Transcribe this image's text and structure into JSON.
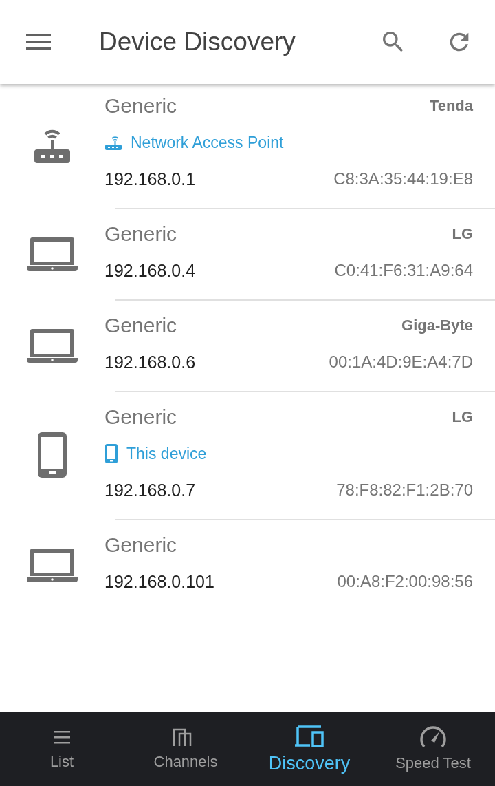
{
  "app_bar": {
    "title": "Device Discovery"
  },
  "devices": [
    {
      "kind": "router",
      "name": "Generic",
      "vendor": "Tenda",
      "tag": {
        "kind": "access-point",
        "label": "Network Access Point"
      },
      "ip": "192.168.0.1",
      "mac": "C8:3A:35:44:19:E8"
    },
    {
      "kind": "laptop",
      "name": "Generic",
      "vendor": "LG",
      "ip": "192.168.0.4",
      "mac": "C0:41:F6:31:A9:64"
    },
    {
      "kind": "laptop",
      "name": "Generic",
      "vendor": "Giga-Byte",
      "ip": "192.168.0.6",
      "mac": "00:1A:4D:9E:A4:7D"
    },
    {
      "kind": "phone",
      "name": "Generic",
      "vendor": "LG",
      "tag": {
        "kind": "this-device",
        "label": "This device"
      },
      "ip": "192.168.0.7",
      "mac": "78:F8:82:F1:2B:70"
    },
    {
      "kind": "laptop",
      "name": "Generic",
      "ip": "192.168.0.101",
      "mac": "00:A8:F2:00:98:56"
    }
  ],
  "bottom_nav": [
    {
      "kind": "list",
      "label": "List",
      "selected": false
    },
    {
      "kind": "channels",
      "label": "Channels",
      "selected": false
    },
    {
      "kind": "discovery",
      "label": "Discovery",
      "selected": true
    },
    {
      "kind": "speed",
      "label": "Speed Test",
      "selected": false
    }
  ]
}
